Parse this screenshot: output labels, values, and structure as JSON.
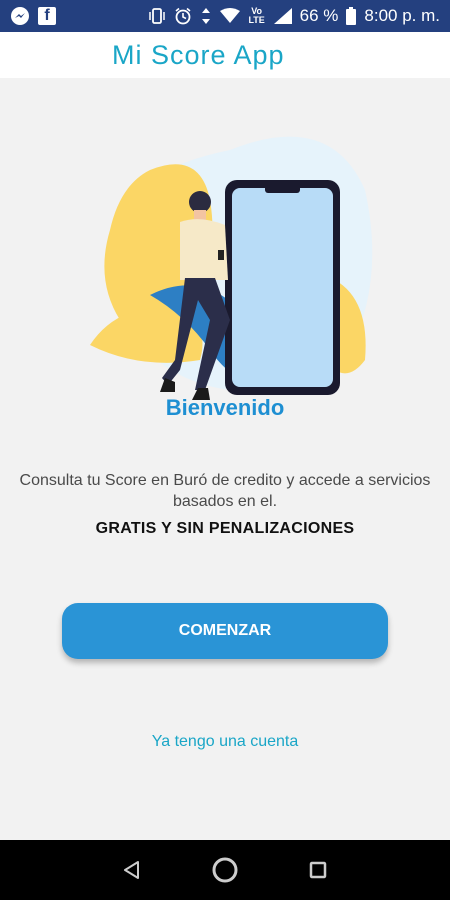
{
  "status_bar": {
    "facebook_letter": "f",
    "volte": "Vo LTE",
    "battery": "66 %",
    "time": "8:00 p. m.",
    "icons": [
      "messenger-icon",
      "facebook-icon",
      "vibrate-icon",
      "alarm-icon",
      "data-arrows-icon",
      "wifi-icon",
      "volte-icon",
      "signal-icon",
      "battery-icon"
    ]
  },
  "header": {
    "title": "Mi Score App"
  },
  "main": {
    "welcome": "Bienvenido",
    "description": "Consulta tu Score en Buró de credito y accede a servicios basados en el.",
    "highlight": "GRATIS Y SIN PENALIZACIONES",
    "start_button": "COMENZAR",
    "login_link": "Ya tengo una cuenta"
  },
  "nav_bar": {
    "icons": [
      "back-icon",
      "home-icon",
      "recents-icon"
    ]
  },
  "colors": {
    "status_bar": "#24407f",
    "accent": "#1aa6c7",
    "button": "#2a94d6",
    "welcome": "#1e8fd2"
  }
}
